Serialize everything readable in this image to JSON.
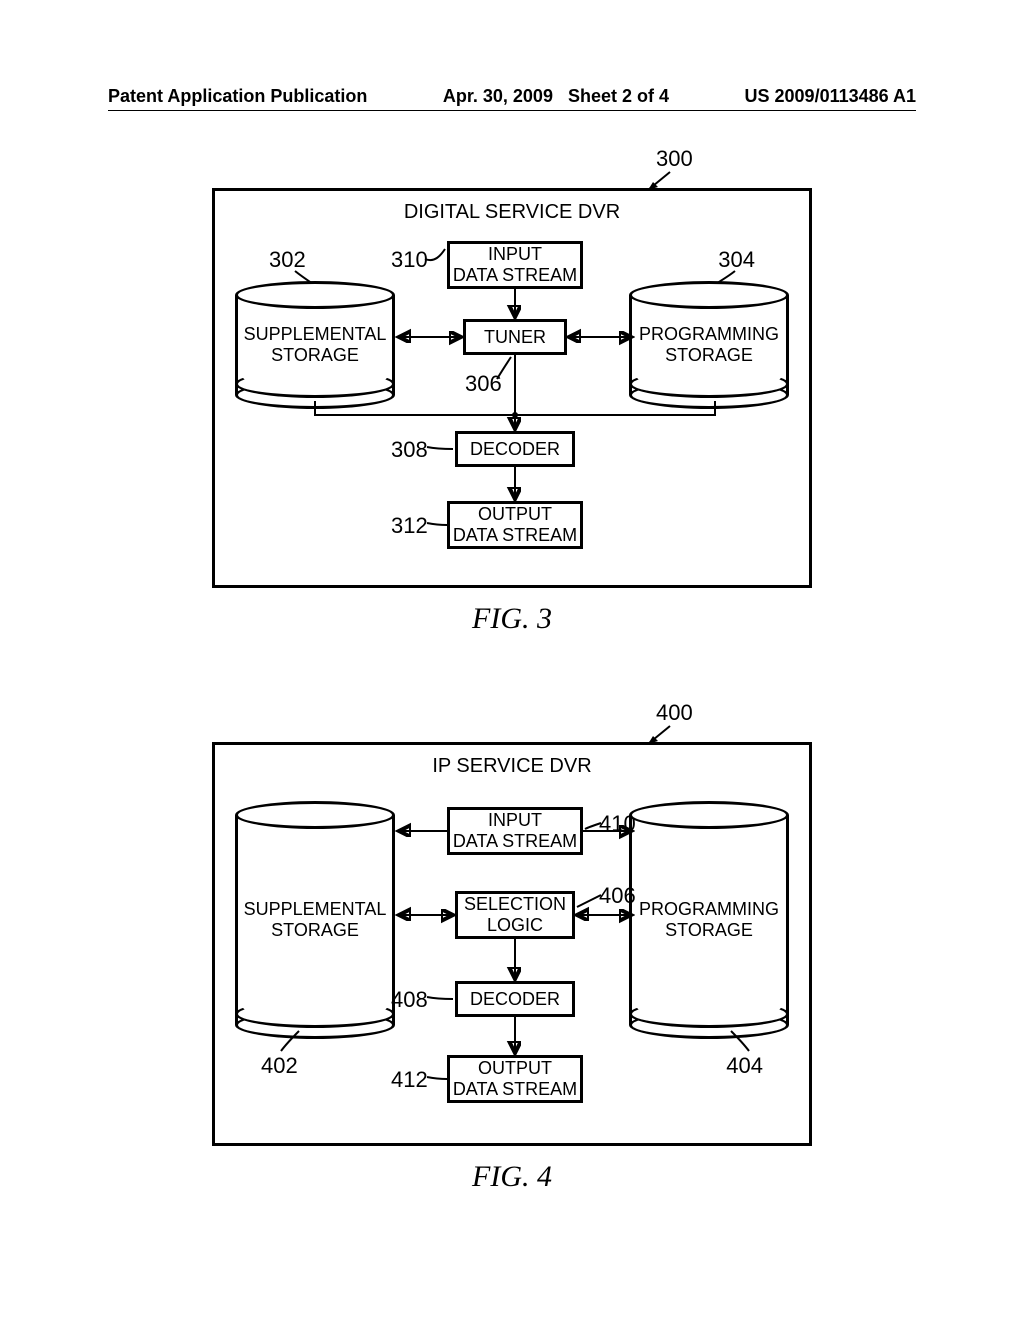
{
  "header": {
    "pub_type": "Patent Application Publication",
    "date": "Apr. 30, 2009",
    "sheet": "Sheet 2 of 4",
    "pub_number": "US 2009/0113486 A1"
  },
  "fig3": {
    "caption": "FIG. 3",
    "box_title": "DIGITAL SERVICE DVR",
    "ref_box": "300",
    "left_cyl": {
      "label": "SUPPLEMENTAL\nSTORAGE",
      "ref": "302"
    },
    "right_cyl": {
      "label": "PROGRAMMING\nSTORAGE",
      "ref": "304"
    },
    "input": {
      "label": "INPUT\nDATA STREAM",
      "ref": "310"
    },
    "tuner": {
      "label": "TUNER",
      "ref": "306"
    },
    "decoder": {
      "label": "DECODER",
      "ref": "308"
    },
    "output": {
      "label": "OUTPUT\nDATA STREAM",
      "ref": "312"
    }
  },
  "fig4": {
    "caption": "FIG. 4",
    "box_title": "IP SERVICE DVR",
    "ref_box": "400",
    "left_cyl": {
      "label": "SUPPLEMENTAL\nSTORAGE",
      "ref": "402"
    },
    "right_cyl": {
      "label": "PROGRAMMING\nSTORAGE",
      "ref": "404"
    },
    "input": {
      "label": "INPUT\nDATA STREAM",
      "ref": "410"
    },
    "sel": {
      "label": "SELECTION\nLOGIC",
      "ref": "406"
    },
    "decoder": {
      "label": "DECODER",
      "ref": "408"
    },
    "output": {
      "label": "OUTPUT\nDATA STREAM",
      "ref": "412"
    }
  }
}
